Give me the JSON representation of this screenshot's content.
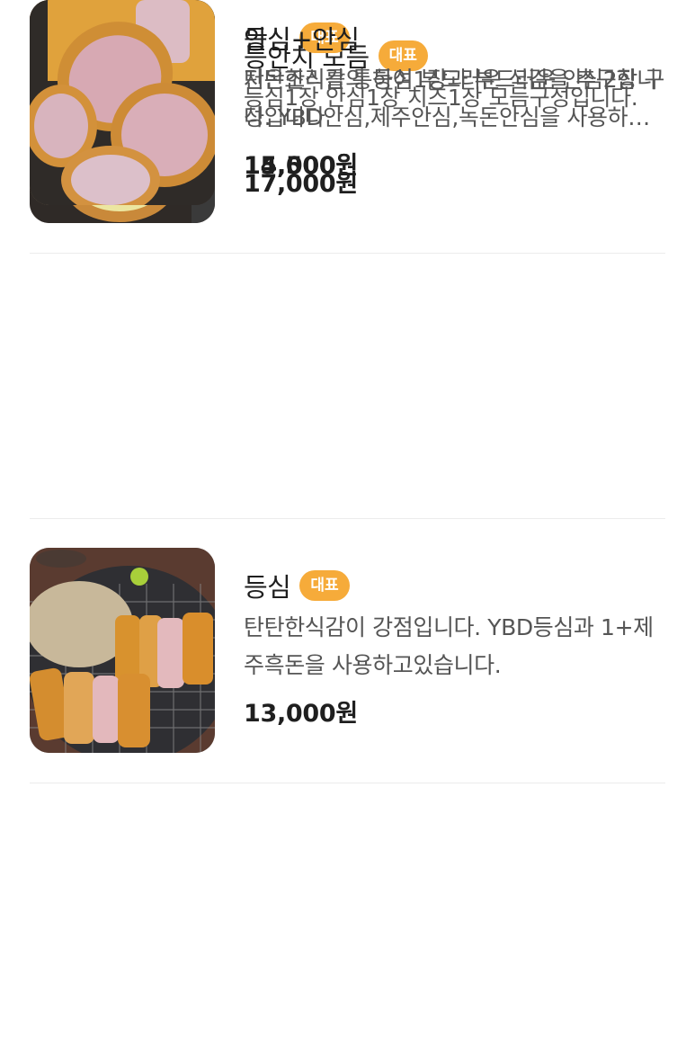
{
  "menu": {
    "items": [
      {
        "name": "등안치 모듬",
        "badge": "대표",
        "description": "등심1장 안심1장 치즈1장 모듬구성입니다.",
        "price": "17,000원",
        "image": "pork-cutlet-cheese-platter"
      },
      {
        "name": "등심",
        "badge": "대표",
        "description": "탄탄한식감이 강점입니다. YBD등심과 1+제주흑돈을 사용하고있습니다.",
        "price": "13,000원",
        "image": "pork-loin-cutlet-on-rack"
      },
      {
        "name": "안심",
        "badge": "대표",
        "description": "저온조리를 통하여 부드러운 식감을 추구합니다. YBD안심,제주안심,녹돈안심을 사용하고 있습니다.",
        "price": "14,000원",
        "image": "pork-tenderloin-cutlet"
      },
      {
        "name": "등심+안심",
        "badge": "",
        "description": "탄탄한식감의 등심1장과 부드러운 안심2장 구성입니다",
        "price": "15,500원",
        "image": "loin-and-tenderloin-cutlet"
      }
    ]
  }
}
